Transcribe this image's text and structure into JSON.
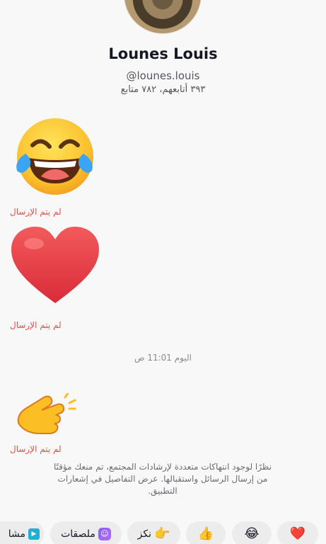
{
  "profile": {
    "name": "Lounes Louis",
    "handle": "@lounes.louis",
    "stats": "٣٩٣ أتابعهم، ٧٨٢ متابع"
  },
  "messages": [
    {
      "emoji": "😂",
      "status": "لم يتم الإرسال"
    },
    {
      "emoji": "❤️",
      "status": "لم يتم الإرسال"
    },
    {
      "emoji": "👋",
      "status": "لم يتم الإرسال"
    }
  ],
  "timestamp": "اليوم 11:01 ص",
  "notice": "نظرًا لوجود انتهاكات متعددة لإرشادات المجتمع، تم منعك مؤقتًا من إرسال الرسائل واستقبالها. عرض التفاصيل في إشعارات التطبيق.",
  "quick_actions": {
    "heart": {
      "icon": "❤️"
    },
    "laugh": {
      "icon": "😂"
    },
    "thumb": {
      "icon": "👍"
    },
    "poke": {
      "icon": "👉",
      "label": "نكز"
    },
    "stickers": {
      "icon": "☺",
      "label": "ملصقات"
    },
    "share": {
      "icon": "▶",
      "label": "مشا"
    }
  }
}
